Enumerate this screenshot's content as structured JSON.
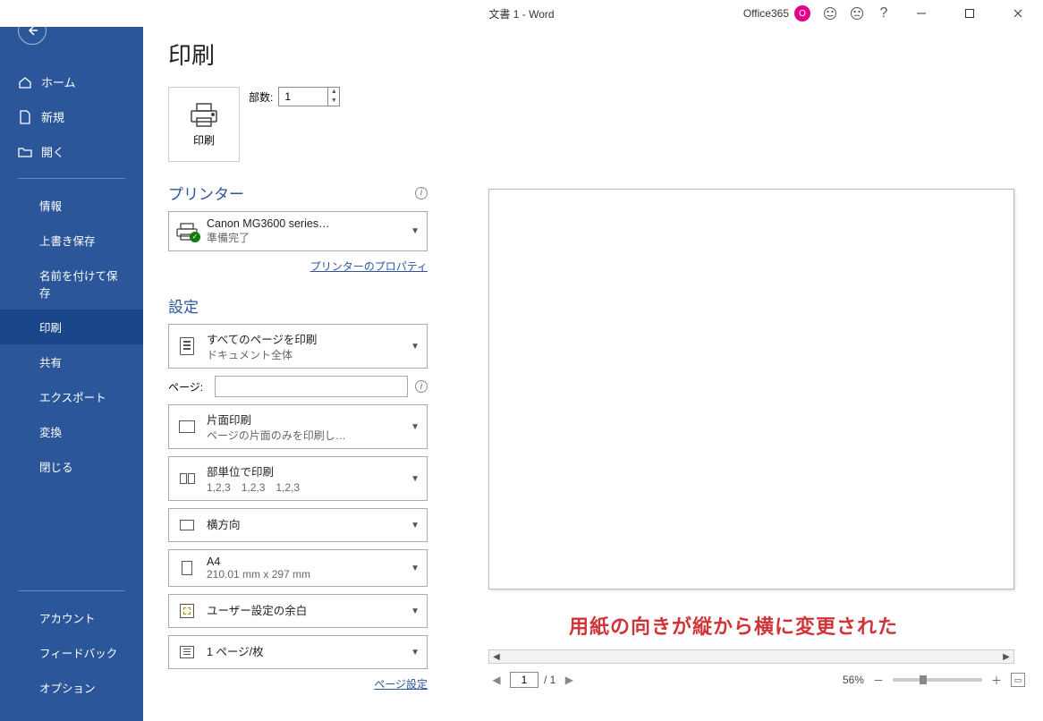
{
  "titlebar": {
    "title": "文書 1  -  Word",
    "user": "Office365",
    "avatar_initial": "O"
  },
  "sidebar": {
    "nav": [
      {
        "label": "ホーム",
        "icon": "home"
      },
      {
        "label": "新規",
        "icon": "doc"
      },
      {
        "label": "開く",
        "icon": "open"
      }
    ],
    "sub": [
      {
        "label": "情報"
      },
      {
        "label": "上書き保存"
      },
      {
        "label": "名前を付けて保存"
      },
      {
        "label": "印刷",
        "active": true
      },
      {
        "label": "共有"
      },
      {
        "label": "エクスポート"
      },
      {
        "label": "変換"
      },
      {
        "label": "閉じる"
      }
    ],
    "bottom": [
      {
        "label": "アカウント"
      },
      {
        "label": "フィードバック"
      },
      {
        "label": "オプション"
      }
    ]
  },
  "page": {
    "title": "印刷"
  },
  "print_button": {
    "label": "印刷"
  },
  "copies": {
    "label": "部数:",
    "value": "1"
  },
  "printer_section": {
    "heading": "プリンター",
    "selected": {
      "name": "Canon MG3600 series…",
      "status": "準備完了"
    },
    "properties_link": "プリンターのプロパティ"
  },
  "settings_section": {
    "heading": "設定",
    "range": {
      "line1": "すべてのページを印刷",
      "line2": "ドキュメント全体"
    },
    "pages_label": "ページ:",
    "pages_value": "",
    "duplex": {
      "line1": "片面印刷",
      "line2": "ページの片面のみを印刷し…"
    },
    "collate": {
      "line1": "部単位で印刷",
      "line2": "1,2,3　1,2,3　1,2,3"
    },
    "orientation": {
      "line1": "横方向"
    },
    "paper": {
      "line1": "A4",
      "line2": "210.01 mm x 297 mm"
    },
    "margins": {
      "line1": "ユーザー設定の余白"
    },
    "nup": {
      "line1": "1 ページ/枚"
    },
    "page_setup_link": "ページ設定"
  },
  "preview": {
    "annotation": "用紙の向きが縦から横に変更された",
    "page_current": "1",
    "page_total": "/ 1",
    "zoom_text": "56%"
  }
}
